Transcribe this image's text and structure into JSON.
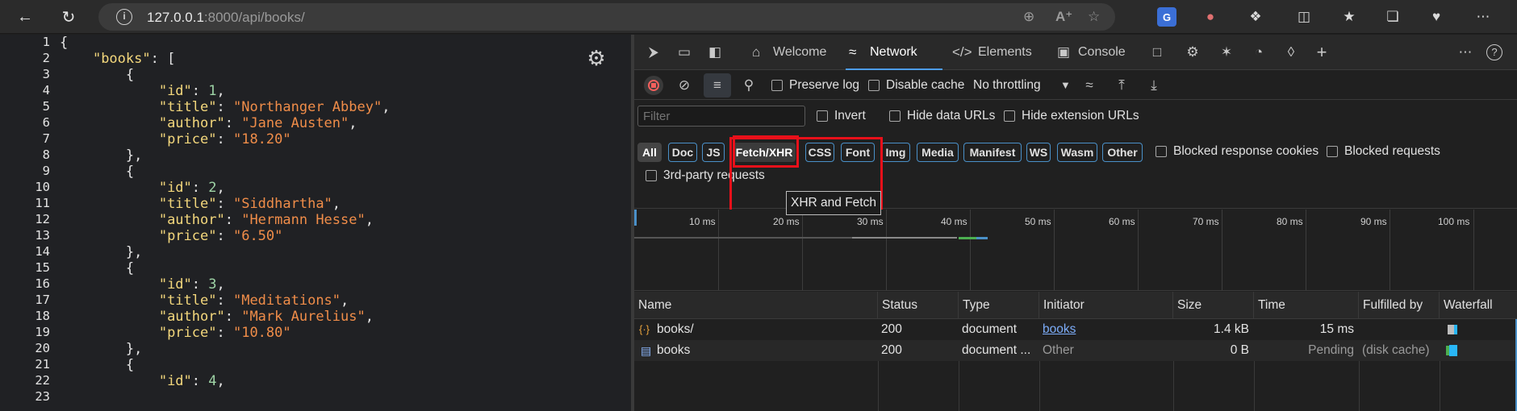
{
  "browser": {
    "url_host": "127.0.0.1",
    "url_rest": ":8000/api/books/"
  },
  "json_view": {
    "line_numbers": [
      "1",
      "2",
      "3",
      "4",
      "5",
      "6",
      "7",
      "8",
      "9",
      "10",
      "11",
      "12",
      "13",
      "14",
      "15",
      "16",
      "17",
      "18",
      "19",
      "20",
      "21",
      "22",
      "23"
    ],
    "books": [
      {
        "id": "1",
        "title": "\"Northanger Abbey\"",
        "author": "\"Jane Austen\"",
        "price": "\"18.20\""
      },
      {
        "id": "2",
        "title": "\"Siddhartha\"",
        "author": "\"Hermann Hesse\"",
        "price": "\"6.50\""
      },
      {
        "id": "3",
        "title": "\"Meditations\"",
        "author": "\"Mark Aurelius\"",
        "price": "\"10.80\""
      },
      {
        "id": "4"
      }
    ],
    "key_books": "\"books\"",
    "key_id": "\"id\"",
    "key_title": "\"title\"",
    "key_author": "\"author\"",
    "key_price": "\"price\""
  },
  "devtools": {
    "tabs": {
      "welcome": "Welcome",
      "network": "Network",
      "elements": "Elements",
      "console": "Console"
    },
    "toolbar": {
      "preserve_log": "Preserve log",
      "disable_cache": "Disable cache",
      "throttling": "No throttling"
    },
    "filter": {
      "placeholder": "Filter",
      "invert": "Invert",
      "hide_data_urls": "Hide data URLs",
      "hide_extension_urls": "Hide extension URLs",
      "types": [
        "All",
        "Doc",
        "JS",
        "Fetch/XHR",
        "CSS",
        "Font",
        "Img",
        "Media",
        "Manifest",
        "WS",
        "Wasm",
        "Other"
      ],
      "blocked_response_cookies": "Blocked response cookies",
      "blocked_requests": "Blocked requests",
      "third_party": "3rd-party requests",
      "tooltip": "XHR and Fetch"
    },
    "timeline": {
      "ticks": [
        "10 ms",
        "20 ms",
        "30 ms",
        "40 ms",
        "50 ms",
        "60 ms",
        "70 ms",
        "80 ms",
        "90 ms",
        "100 ms"
      ]
    },
    "table": {
      "columns": {
        "name": "Name",
        "status": "Status",
        "type": "Type",
        "initiator": "Initiator",
        "size": "Size",
        "time": "Time",
        "fulfilled_by": "Fulfilled by",
        "waterfall": "Waterfall"
      },
      "rows": [
        {
          "name": "books/",
          "status": "200",
          "type": "document",
          "initiator": "books",
          "size": "1.4 kB",
          "time": "15 ms",
          "fulfilled_by": ""
        },
        {
          "name": "books",
          "status": "200",
          "type": "document ...",
          "initiator": "Other",
          "size": "0 B",
          "time": "Pending",
          "fulfilled_by": "(disk cache)"
        }
      ]
    }
  }
}
